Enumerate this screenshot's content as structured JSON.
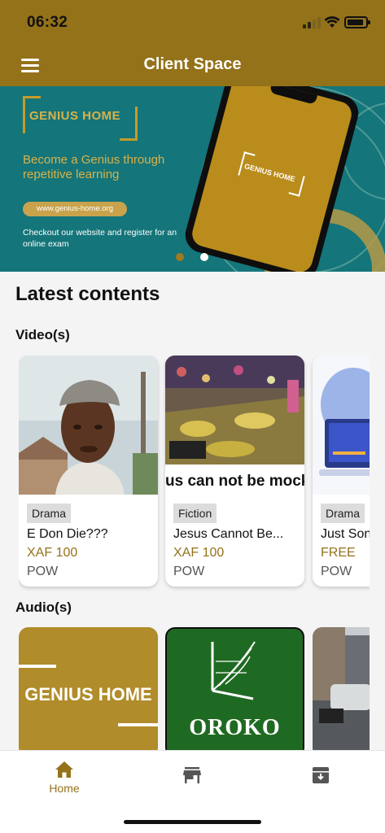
{
  "status_bar": {
    "time": "06:32"
  },
  "header": {
    "title": "Client Space",
    "menu_icon": "hamburger-menu-icon"
  },
  "banner": {
    "logo_text": "GENIUS HOME",
    "tagline": "Become a Genius through repetitive learning",
    "url": "www.genius-home.org",
    "checkout_text": "Checkout our website and register for an online exam",
    "phone_logo_text": "GENIUS HOME",
    "dots": [
      {
        "active": true
      },
      {
        "active": false
      }
    ]
  },
  "colors": {
    "brand": "#94721a",
    "teal": "#14757a",
    "gold": "#d9b24a"
  },
  "main": {
    "section_title": "Latest contents",
    "videos_label": "Video(s)",
    "audios_label": "Audio(s)",
    "videos": [
      {
        "tag": "Drama",
        "title": "E Don Die???",
        "price": "XAF 100",
        "author": "POW"
      },
      {
        "tag": "Fiction",
        "title": "Jesus Cannot Be...",
        "price": "XAF 100",
        "author": "POW",
        "thumb_caption": "us can not be mocked"
      },
      {
        "tag": "Drama",
        "title": "Just Son",
        "price": "FREE",
        "author": "POW"
      }
    ],
    "audios": [
      {
        "thumb_text": "GENIUS HOME"
      },
      {
        "thumb_text": "OROKO"
      },
      {
        "thumb_text": ""
      }
    ]
  },
  "bottom_nav": {
    "items": [
      {
        "label": "Home",
        "icon": "home-icon"
      },
      {
        "label": "",
        "icon": "store-icon"
      },
      {
        "label": "",
        "icon": "archive-icon"
      }
    ]
  }
}
